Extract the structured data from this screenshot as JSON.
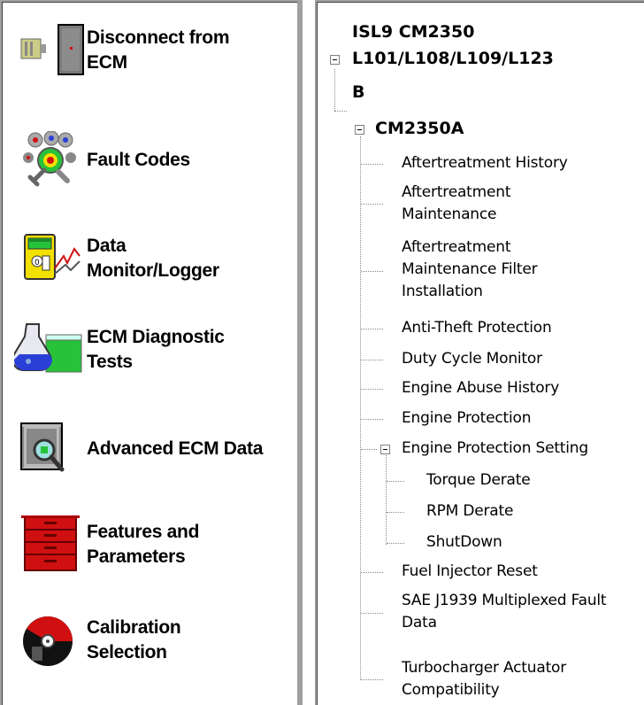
{
  "nav": {
    "items": [
      {
        "label": "Disconnect from ECM",
        "icon": "disconnect-icon"
      },
      {
        "label": "Fault Codes",
        "icon": "fault-codes-icon"
      },
      {
        "label": "Data Monitor/Logger",
        "icon": "data-monitor-icon"
      },
      {
        "label": "ECM Diagnostic Tests",
        "icon": "diagnostic-flask-icon"
      },
      {
        "label": "Advanced ECM Data",
        "icon": "advanced-data-icon"
      },
      {
        "label": "Features and Parameters",
        "icon": "toolbox-icon"
      },
      {
        "label": "Calibration Selection",
        "icon": "calibration-disc-icon"
      }
    ]
  },
  "tree": {
    "root_line1": "ISL9 CM2350",
    "root_line2": "L101/L108/L109/L123",
    "root_line3": "B",
    "ecm": "CM2350A",
    "nodes": [
      "Aftertreatment History",
      "Aftertreatment Maintenance",
      "Aftertreatment Maintenance Filter Installation",
      "Anti-Theft Protection",
      "Duty Cycle Monitor",
      "Engine Abuse History",
      "Engine Protection",
      "Engine Protection Setting",
      "Fuel Injector Reset",
      "SAE J1939 Multiplexed Fault Data",
      "Turbocharger Actuator Compatibility"
    ],
    "engine_protection_children": [
      "Torque Derate",
      "RPM Derate",
      "ShutDown"
    ]
  },
  "colors": {
    "panel_border": "#a0a0a0",
    "icon_red": "#d01010",
    "icon_yellow": "#f2e100",
    "icon_green": "#27c23a",
    "icon_blue": "#2a3fd6"
  }
}
